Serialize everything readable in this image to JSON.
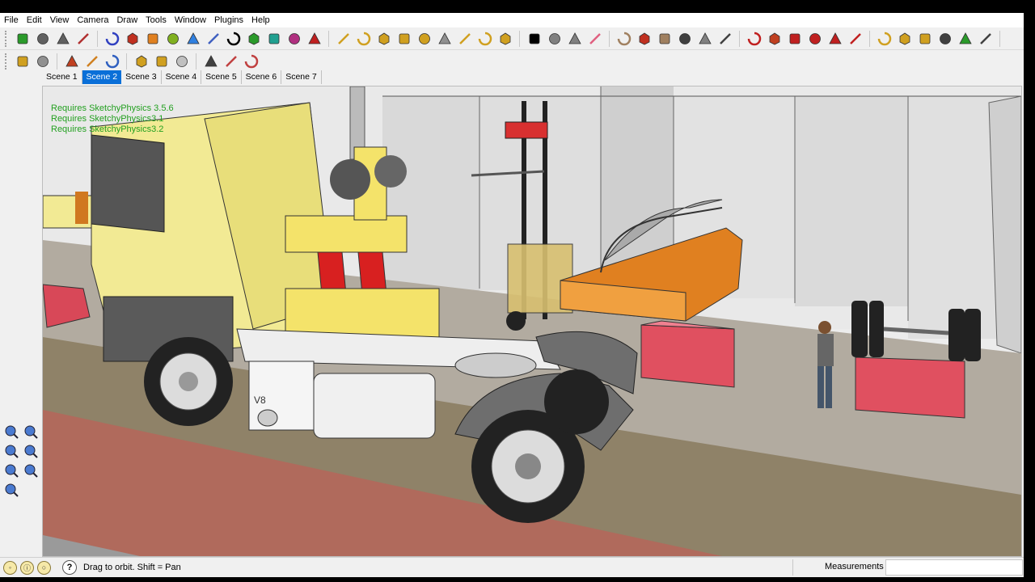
{
  "menu": [
    "File",
    "Edit",
    "View",
    "Camera",
    "Draw",
    "Tools",
    "Window",
    "Plugins",
    "Help"
  ],
  "toolbar1": [
    {
      "name": "play-icon",
      "color": "#2a9a2a"
    },
    {
      "name": "rewind-icon",
      "color": "#606060"
    },
    {
      "name": "pause-icon",
      "color": "#606060"
    },
    {
      "name": "physics-settings-icon",
      "color": "#b03030"
    },
    {
      "name": "rotate-icon",
      "color": "#3040c0"
    },
    {
      "name": "line-icon",
      "color": "#c03020"
    },
    {
      "name": "orbit-ring-icon",
      "color": "#e08020"
    },
    {
      "name": "pencil-icon",
      "color": "#80b020"
    },
    {
      "name": "refresh-icon",
      "color": "#3080e0"
    },
    {
      "name": "hand-icon",
      "color": "#4060c0"
    },
    {
      "name": "ellipse-icon",
      "color": "#000000"
    },
    {
      "name": "gem-icon",
      "color": "#2a9a2a"
    },
    {
      "name": "spring-icon",
      "color": "#20a090"
    },
    {
      "name": "tube-icon",
      "color": "#b03080"
    },
    {
      "name": "cross-icon",
      "color": "#c02020"
    },
    {
      "name": "cube-icon",
      "color": "#d0a020"
    },
    {
      "name": "sphere-icon",
      "color": "#d0a020"
    },
    {
      "name": "cylinder-icon",
      "color": "#d0a020"
    },
    {
      "name": "cone-icon",
      "color": "#d0a020"
    },
    {
      "name": "capsule-icon",
      "color": "#d0a020"
    },
    {
      "name": "plate-icon",
      "color": "#909090"
    },
    {
      "name": "torus-icon",
      "color": "#d0a020"
    },
    {
      "name": "chamfer-icon",
      "color": "#d0a020"
    },
    {
      "name": "push-icon",
      "color": "#d0a020"
    },
    {
      "name": "select-arrow-icon",
      "color": "#000000"
    },
    {
      "name": "component-icon",
      "color": "#808080"
    },
    {
      "name": "paint-bucket-icon",
      "color": "#808080"
    },
    {
      "name": "eraser-icon",
      "color": "#e06080"
    },
    {
      "name": "rectangle-icon",
      "color": "#a08060"
    },
    {
      "name": "freehand-line-icon",
      "color": "#c03020"
    },
    {
      "name": "circle-icon",
      "color": "#a08060"
    },
    {
      "name": "arc-icon",
      "color": "#404040"
    },
    {
      "name": "polygon-icon",
      "color": "#808080"
    },
    {
      "name": "offset-icon",
      "color": "#404040"
    },
    {
      "name": "move-icon",
      "color": "#c02020"
    },
    {
      "name": "push-pull-icon",
      "color": "#c04020"
    },
    {
      "name": "rotate-tool-icon",
      "color": "#c02020"
    },
    {
      "name": "follow-me-icon",
      "color": "#c02020"
    },
    {
      "name": "scale-icon",
      "color": "#c02020"
    },
    {
      "name": "offset-tool-icon",
      "color": "#c02020"
    },
    {
      "name": "tape-measure-icon",
      "color": "#d0a020"
    },
    {
      "name": "dimension-icon",
      "color": "#d0a020"
    },
    {
      "name": "protractor-icon",
      "color": "#d0a020"
    },
    {
      "name": "text-icon",
      "color": "#404040"
    },
    {
      "name": "axes-icon",
      "color": "#2a9a2a"
    },
    {
      "name": "3d-text-icon",
      "color": "#404040"
    }
  ],
  "toolbar2": [
    {
      "name": "joint-hinge-icon",
      "color": "#d0a020"
    },
    {
      "name": "joint-servo-icon",
      "color": "#909090"
    },
    {
      "name": "joint-slider-icon",
      "color": "#c04020"
    },
    {
      "name": "joint-piston-icon",
      "color": "#d08020"
    },
    {
      "name": "joint-ball-icon",
      "color": "#3060c0"
    },
    {
      "name": "joint-spring-icon",
      "color": "#d0a020"
    },
    {
      "name": "joint-gear-icon",
      "color": "#d0a020"
    },
    {
      "name": "joint-fixed-icon",
      "color": "#c0c0c0"
    },
    {
      "name": "camera-orbit-icon",
      "color": "#404040"
    },
    {
      "name": "camera-position-icon",
      "color": "#c04040"
    },
    {
      "name": "camera-target-icon",
      "color": "#c04040"
    }
  ],
  "scenes": {
    "tabs": [
      "Scene 1",
      "Scene 2",
      "Scene 3",
      "Scene 4",
      "Scene 5",
      "Scene 6",
      "Scene 7"
    ],
    "active_index": 1
  },
  "viewport": {
    "requirement_lines": [
      "Requires SketchyPhysics 3.5.6",
      "Requires SketchyPhysics3.1",
      "Requires SketchyPhysics3.2"
    ],
    "requirement_color": "#23a020",
    "badge_text": "V8"
  },
  "left_tools": [
    {
      "name": "orbit-tool-icon"
    },
    {
      "name": "pan-tool-icon"
    },
    {
      "name": "zoom-tool-icon"
    },
    {
      "name": "zoom-window-icon"
    },
    {
      "name": "zoom-extents-icon"
    },
    {
      "name": "previous-view-icon"
    },
    {
      "name": "position-camera-icon"
    }
  ],
  "status": {
    "hint": "Drag to orbit.  Shift = Pan",
    "measurements_label": "Measurements",
    "measurements_value": ""
  }
}
